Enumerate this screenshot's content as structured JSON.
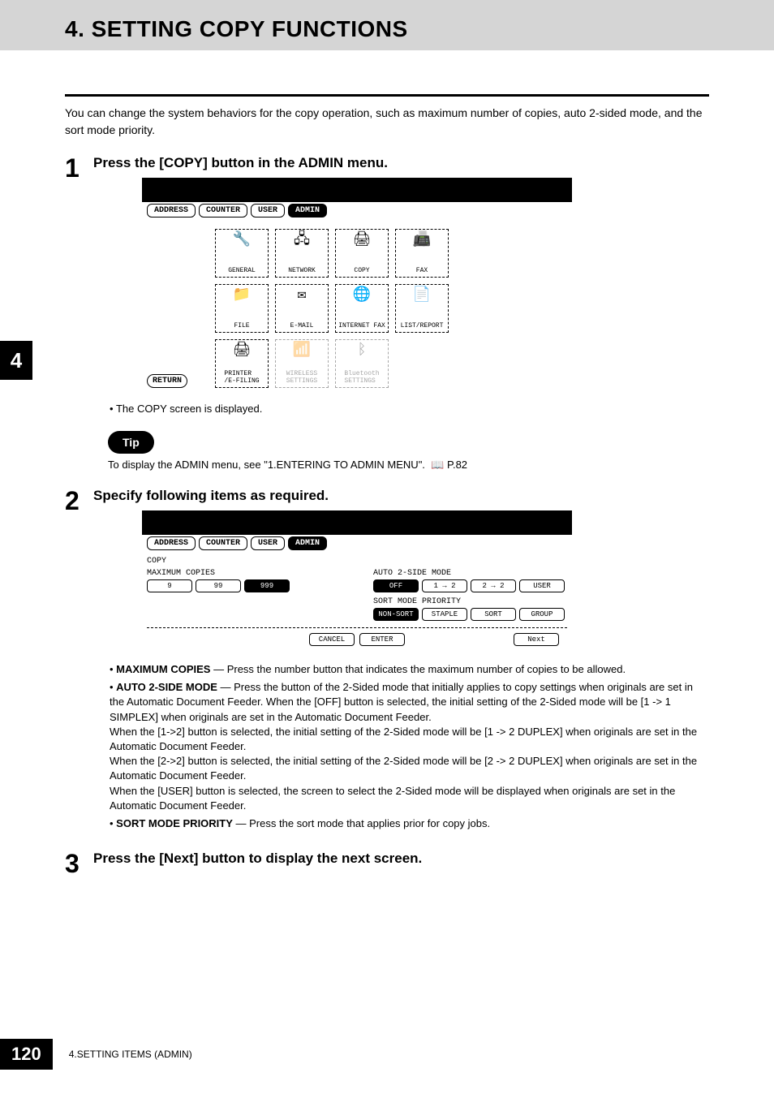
{
  "header": {
    "title": "4. SETTING COPY FUNCTIONS"
  },
  "intro": "You can change the system behaviors for the copy operation, such as maximum number of copies, auto 2-sided mode, and the sort mode priority.",
  "sideTab": "4",
  "steps": {
    "s1": {
      "num": "1",
      "title": "Press the [COPY] button in the ADMIN menu.",
      "note": "The COPY screen is displayed."
    },
    "s2": {
      "num": "2",
      "title": "Specify following items as required."
    },
    "s3": {
      "num": "3",
      "title": "Press the [Next] button to display the next screen."
    }
  },
  "screen1": {
    "tabs": {
      "address": "ADDRESS",
      "counter": "COUNTER",
      "user": "USER",
      "admin": "ADMIN"
    },
    "returnBtn": "RETURN",
    "icons": {
      "general": "GENERAL",
      "network": "NETWORK",
      "copy": "COPY",
      "fax": "FAX",
      "file": "FILE",
      "email": "E-MAIL",
      "internetfax": "INTERNET FAX",
      "listreport": "LIST/REPORT",
      "printer": "PRINTER\n/E-FILING",
      "wireless": "WIRELESS\nSETTINGS",
      "bluetooth": "Bluetooth\nSETTINGS"
    }
  },
  "tip": {
    "label": "Tip",
    "text": "To display the ADMIN menu, see \"1.ENTERING TO ADMIN MENU\".",
    "pageRef": "P.82",
    "bookGlyph": "📖"
  },
  "screen2": {
    "tabs": {
      "address": "ADDRESS",
      "counter": "COUNTER",
      "user": "USER",
      "admin": "ADMIN"
    },
    "section": "COPY",
    "maxCopiesLabel": "MAXIMUM COPIES",
    "maxCopies": {
      "b1": "9",
      "b2": "99",
      "b3": "999"
    },
    "auto2sideLabel": "AUTO 2-SIDE MODE",
    "auto2side": {
      "off": "OFF",
      "b1": "1 → 2",
      "b2": "2 → 2",
      "user": "USER"
    },
    "sortModeLabel": "SORT MODE PRIORITY",
    "sortMode": {
      "nonsort": "NON-SORT",
      "staple": "STAPLE",
      "sort": "SORT",
      "group": "GROUP"
    },
    "cancel": "CANCEL",
    "enter": "ENTER",
    "next": "Next"
  },
  "descriptions": {
    "maxCopies": {
      "term": "MAXIMUM COPIES",
      "text": " — Press the number button that indicates the maximum number of copies to be allowed."
    },
    "auto2side": {
      "term": "AUTO 2-SIDE MODE",
      "text": " — Press the button of the 2-Sided mode that initially applies to copy settings when originals are set in the Automatic Document Feeder.  When the [OFF] button is selected, the initial setting of the 2-Sided mode will be [1 -> 1 SIMPLEX] when originals are set in the Automatic Document Feeder.",
      "p2": "When the [1->2] button is selected, the initial setting of the 2-Sided mode will be [1 -> 2 DUPLEX] when originals are set in the Automatic Document Feeder.",
      "p3": "When the [2->2] button is selected, the initial setting of the 2-Sided mode will be [2 -> 2 DUPLEX] when originals are set in the Automatic Document Feeder.",
      "p4": "When the [USER] button is selected, the screen to select the 2-Sided mode will be displayed when originals are set in the Automatic Document Feeder."
    },
    "sortMode": {
      "term": "SORT MODE PRIORITY",
      "text": " — Press the sort mode that applies prior for copy jobs."
    }
  },
  "footer": {
    "pageNum": "120",
    "text": "4.SETTING ITEMS (ADMIN)"
  }
}
